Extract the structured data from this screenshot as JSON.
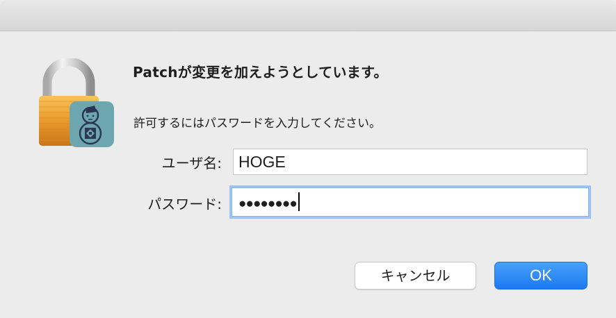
{
  "dialog": {
    "heading": "Patchが変更を加えようとしています。",
    "message": "許可するにはパスワードを入力してください。"
  },
  "form": {
    "username_label": "ユーザ名:",
    "username_value": "HOGE",
    "password_label": "パスワード:",
    "password_masked": "●●●●●●●●"
  },
  "buttons": {
    "cancel_label": "キャンセル",
    "ok_label": "OK"
  },
  "colors": {
    "accent": "#1a79f0",
    "focus_ring": "#9cc3f3",
    "lock_gold": "#e79c2d",
    "app_badge": "#6ea6b0"
  },
  "icons": {
    "lock": "lock-icon",
    "app_badge": "snowman-app-icon"
  }
}
